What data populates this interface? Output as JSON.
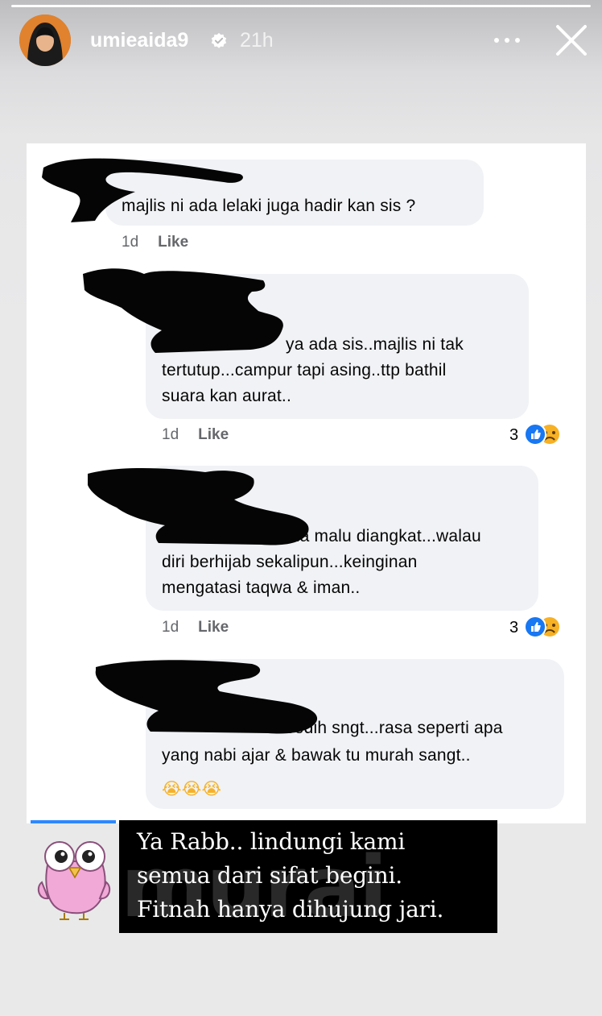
{
  "story": {
    "username": "umieaida9",
    "time": "21h",
    "verified_icon": "verified-badge-icon",
    "more_icon": "more-dots-icon",
    "close_icon": "close-icon"
  },
  "comments": [
    {
      "text_lines": [
        "majlis ni ada lelaki juga hadir kan sis ?"
      ],
      "age": "1d",
      "like": "Like"
    },
    {
      "text_lines": [
        "ya ada sis..majlis ni tak",
        "tertutup...campur tapi asing..ttp bathil",
        "suara kan aurat.."
      ],
      "age": "1d",
      "like": "Like",
      "reaction_count": "3",
      "reactions": [
        "like",
        "sad"
      ]
    },
    {
      "text_lines": [
        "bila malu diangkat...walau",
        "diri berhijab sekalipun...keinginan",
        "mengatasi taqwa & iman.."
      ],
      "age": "1d",
      "like": "Like",
      "reaction_count": "3",
      "reactions": [
        "like",
        "sad"
      ]
    },
    {
      "text_lines": [
        "sedih sngt...rasa seperti apa",
        "yang nabi ajar & bawak tu murah sangt.."
      ],
      "emoji_line": "😭😭😭"
    }
  ],
  "caption": {
    "lines": [
      "Ya Rabb.. lindungi kami",
      "semua dari sifat begini.",
      "Fitnah hanya dihujung jari."
    ]
  },
  "watermark": "murai",
  "colors": {
    "bubble": "#f0f2f5",
    "like_blue": "#1877f2",
    "sad_yellow": "#f7b125",
    "caption_bg": "#000000"
  }
}
